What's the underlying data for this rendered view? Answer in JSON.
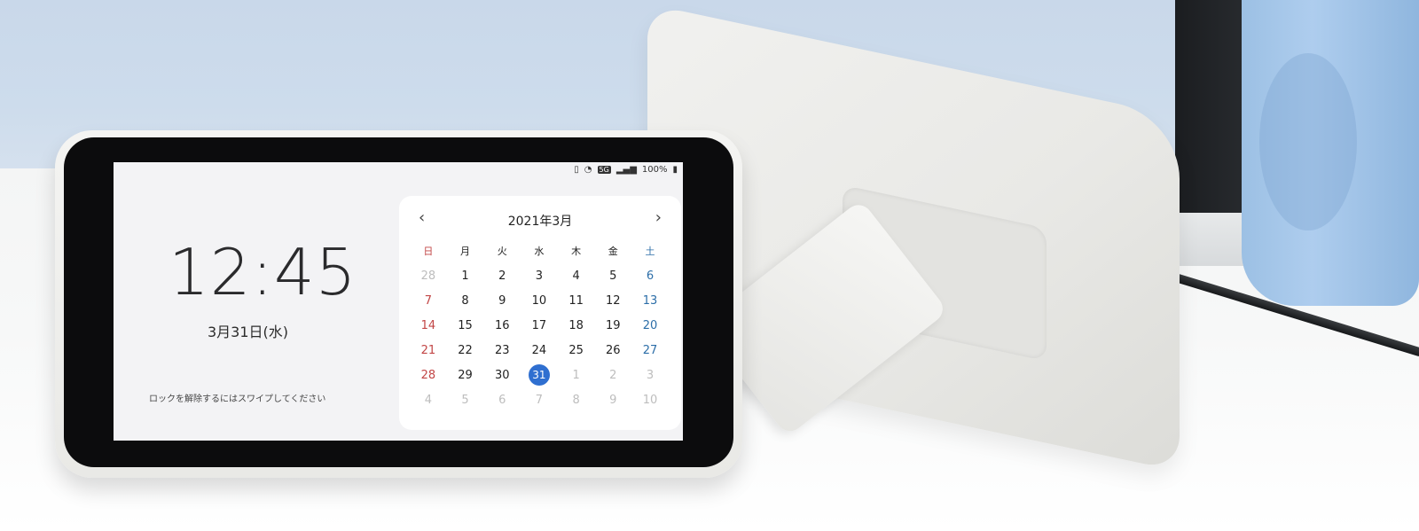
{
  "device": {
    "status_bar": {
      "icons": [
        "vibrate-icon",
        "wifi-icon",
        "network-5g-icon",
        "signal-icon",
        "battery-icon"
      ],
      "network_label": "5G",
      "battery": "100%"
    },
    "lock_screen": {
      "time": "12:45",
      "date": "3月31日(水)",
      "unlock_hint": "ロックを解除するにはスワイプしてください"
    },
    "calendar": {
      "month_title": "2021年3月",
      "prev_icon": "‹",
      "next_icon": "›",
      "weekdays": [
        "日",
        "月",
        "火",
        "水",
        "木",
        "金",
        "土"
      ],
      "weeks": [
        [
          "28",
          "1",
          "2",
          "3",
          "4",
          "5",
          "6"
        ],
        [
          "7",
          "8",
          "9",
          "10",
          "11",
          "12",
          "13"
        ],
        [
          "14",
          "15",
          "16",
          "17",
          "18",
          "19",
          "20"
        ],
        [
          "21",
          "22",
          "23",
          "24",
          "25",
          "26",
          "27"
        ],
        [
          "28",
          "29",
          "30",
          "31",
          "1",
          "2",
          "3"
        ],
        [
          "4",
          "5",
          "6",
          "7",
          "8",
          "9",
          "10"
        ]
      ],
      "selected_day": "31",
      "colors": {
        "sunday": "#c24646",
        "saturday": "#2c6ea8",
        "selected": "#2f6fd0"
      }
    }
  }
}
